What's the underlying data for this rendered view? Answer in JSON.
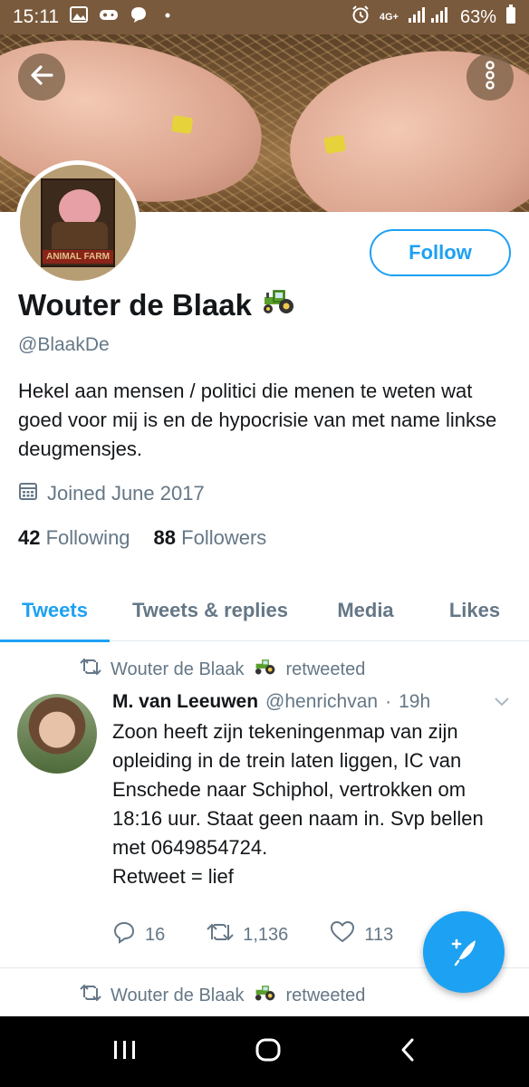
{
  "status_bar": {
    "time": "15:11",
    "network": "4G+",
    "battery": "63%",
    "icons": [
      "image-icon",
      "game-icon",
      "chat-icon",
      "dot-icon",
      "alarm-icon",
      "signal-icon",
      "battery-icon"
    ]
  },
  "header": {
    "back_icon": "arrow-left-icon",
    "more_icon": "more-vertical-icon"
  },
  "avatar": {
    "poster_text": "ANIMAL FARM"
  },
  "profile": {
    "follow_label": "Follow",
    "display_name": "Wouter de Blaak",
    "emoji": "tractor-icon",
    "handle": "@BlaakDe",
    "bio": "Hekel aan mensen / politici die menen te weten wat goed voor mij is en de hypocrisie van met name linkse deugmensjes.",
    "joined": "Joined June 2017",
    "following_count": "42",
    "following_label": "Following",
    "followers_count": "88",
    "followers_label": "Followers"
  },
  "tabs": [
    {
      "label": "Tweets",
      "active": true
    },
    {
      "label": "Tweets & replies",
      "active": false
    },
    {
      "label": "Media",
      "active": false
    },
    {
      "label": "Likes",
      "active": false
    }
  ],
  "tweets": [
    {
      "retweeted_by": "Wouter de Blaak",
      "retweeted_suffix": "retweeted",
      "author_name": "M. van Leeuwen",
      "author_handle": "@henrichvan",
      "separator": "·",
      "time": "19h",
      "text": "Zoon heeft zijn tekeningenmap van zijn opleiding in de trein laten liggen, IC van Enschede naar Schiphol, vertrokken om 18:16 uur. Staat geen naam in. Svp bellen met 0649854724.\nRetweet = lief",
      "replies": "16",
      "retweets": "1,136",
      "likes": "113"
    },
    {
      "retweeted_by": "Wouter de Blaak",
      "retweeted_suffix": "retweeted"
    }
  ],
  "colors": {
    "accent": "#1da1f2",
    "text_primary": "#14171a",
    "text_secondary": "#657786",
    "border": "#e1e8ed"
  }
}
